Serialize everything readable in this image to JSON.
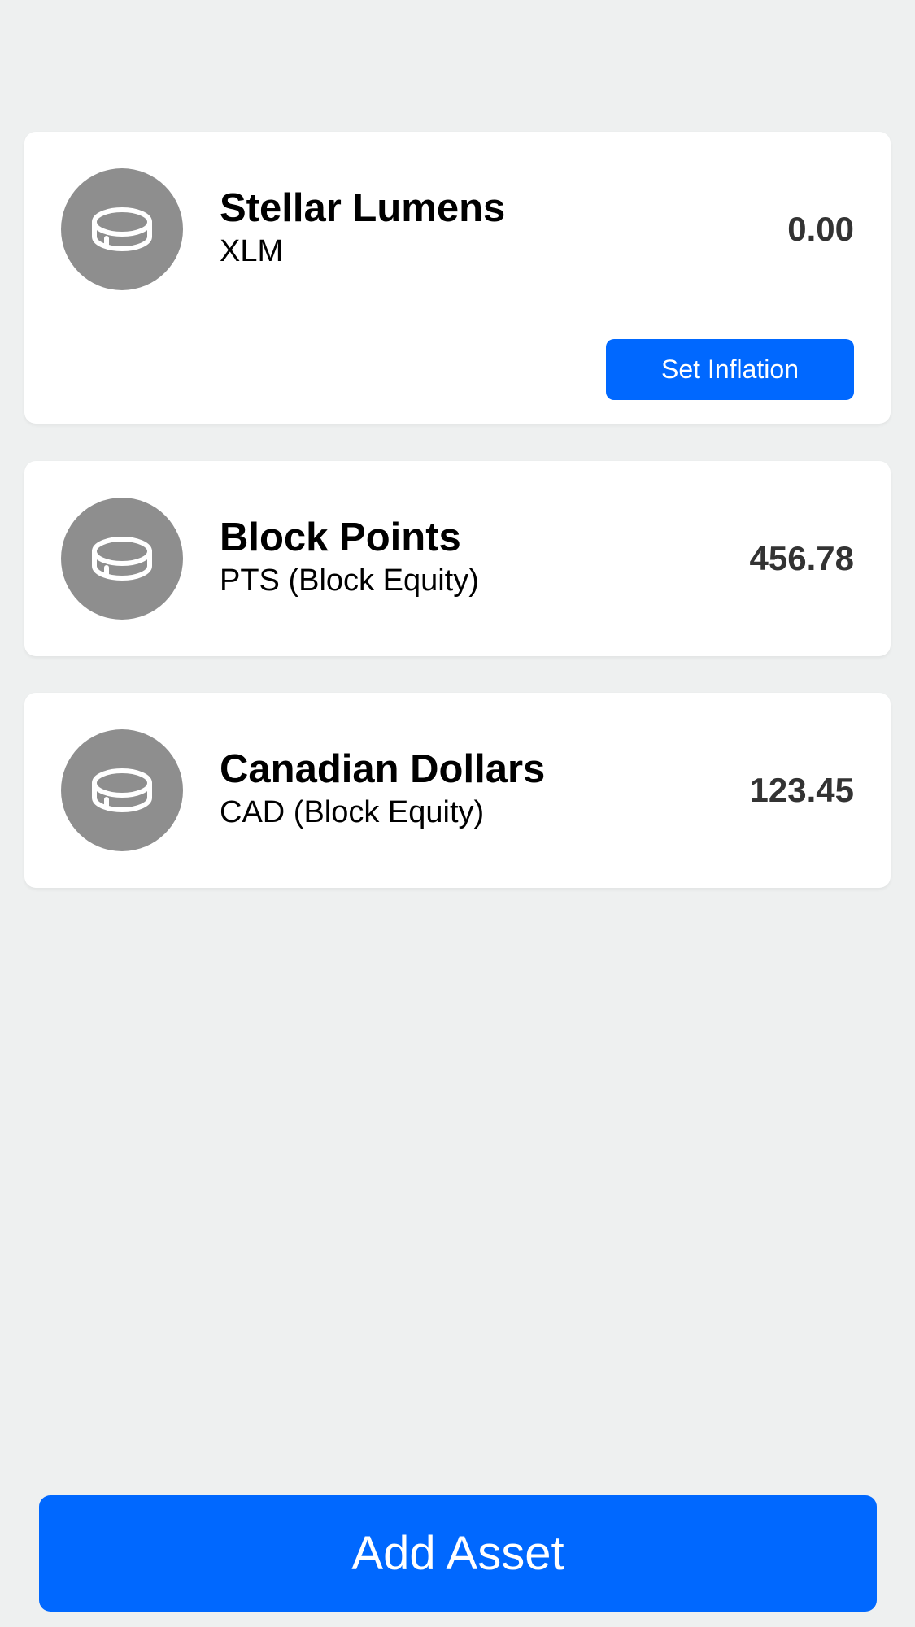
{
  "assets": [
    {
      "name": "Stellar Lumens",
      "code": "XLM",
      "balance": "0.00",
      "icon": "coin-icon",
      "action_label": "Set Inflation"
    },
    {
      "name": "Block Points",
      "code": "PTS (Block Equity)",
      "balance": "456.78",
      "icon": "coin-icon"
    },
    {
      "name": "Canadian Dollars",
      "code": "CAD (Block Equity)",
      "balance": "123.45",
      "icon": "coin-icon"
    }
  ],
  "footer": {
    "add_asset_label": "Add Asset"
  },
  "colors": {
    "accent": "#0068ff",
    "background": "#eef0f0",
    "card": "#ffffff",
    "icon_circle": "#8e8e8e",
    "balance_text": "#333333"
  }
}
